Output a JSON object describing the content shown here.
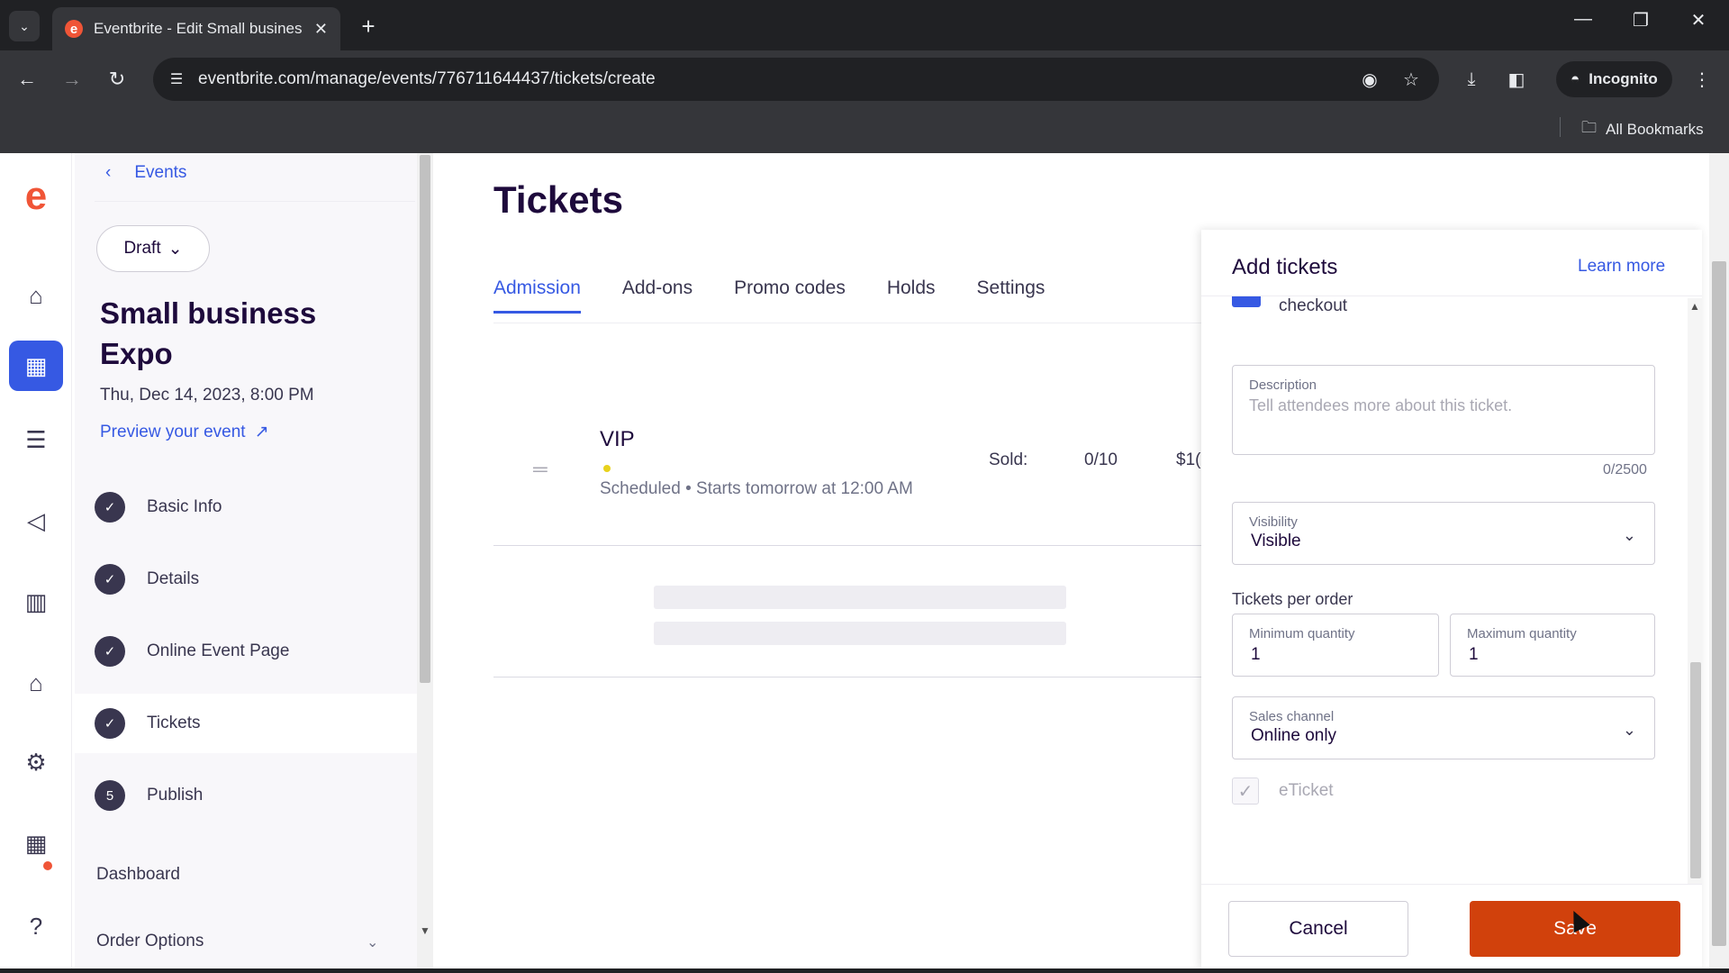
{
  "browser": {
    "tab_title": "Eventbrite - Edit Small busines",
    "url": "eventbrite.com/manage/events/776711644437/tickets/create",
    "incognito_label": "Incognito",
    "bookmarks_label": "All Bookmarks"
  },
  "sidebar": {
    "back_label": "Events",
    "status_label": "Draft",
    "event_title": "Small business Expo",
    "event_date": "Thu, Dec 14, 2023, 8:00 PM",
    "preview_label": "Preview your event",
    "steps": [
      {
        "label": "Basic Info",
        "marker": "✓"
      },
      {
        "label": "Details",
        "marker": "✓"
      },
      {
        "label": "Online Event Page",
        "marker": "✓"
      },
      {
        "label": "Tickets",
        "marker": "✓"
      },
      {
        "label": "Publish",
        "marker": "5"
      }
    ],
    "dashboard_label": "Dashboard",
    "order_options_label": "Order Options"
  },
  "main": {
    "title": "Tickets",
    "tabs": [
      "Admission",
      "Add-ons",
      "Promo codes",
      "Holds",
      "Settings"
    ],
    "ticket": {
      "name": "VIP",
      "status": "Scheduled",
      "starts": "Starts tomorrow at 12:00 AM",
      "sold_label": "Sold:",
      "sold_value": "0/10",
      "price": "$1("
    }
  },
  "drawer": {
    "title": "Add tickets",
    "learn_more": "Learn more",
    "checkout_label": "checkout",
    "description": {
      "label": "Description",
      "placeholder": "Tell attendees more about this ticket.",
      "count": "0/2500"
    },
    "visibility": {
      "label": "Visibility",
      "value": "Visible"
    },
    "tickets_per_order_label": "Tickets per order",
    "min_qty": {
      "label": "Minimum quantity",
      "value": "1"
    },
    "max_qty": {
      "label": "Maximum quantity",
      "value": "1"
    },
    "sales_channel": {
      "label": "Sales channel",
      "value": "Online only"
    },
    "eticket_label": "eTicket",
    "cancel_label": "Cancel",
    "save_label": "Save"
  },
  "colors": {
    "brand": "#f05537",
    "primary_blue": "#3659e3",
    "save_button": "#d1410c"
  }
}
